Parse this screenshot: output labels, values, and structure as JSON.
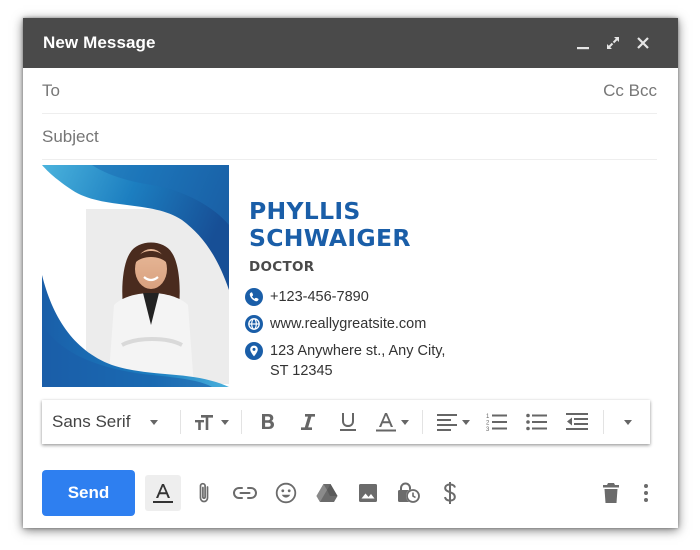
{
  "window": {
    "title": "New Message",
    "controls": [
      {
        "name": "minimize",
        "icon": "minimize-icon"
      },
      {
        "name": "expand",
        "icon": "expand-icon"
      },
      {
        "name": "close",
        "icon": "close-icon"
      }
    ]
  },
  "fields": {
    "to_label": "To",
    "to_value": "",
    "cc_label": "Cc",
    "bcc_label": "Bcc",
    "subject_placeholder": "Subject",
    "subject_value": ""
  },
  "signature": {
    "name_line1": "PHYLLIS",
    "name_line2": "SCHWAIGER",
    "role": "DOCTOR",
    "phone": "+123-456-7890",
    "website": "www.reallygreatsite.com",
    "address_line1": "123 Anywhere st., Any City,",
    "address_line2": "ST 12345",
    "accent_color": "#1a5ea8"
  },
  "format_toolbar": {
    "font": "Sans Serif",
    "items": [
      "font-size",
      "bold",
      "italic",
      "underline",
      "text-color",
      "align",
      "numbered-list",
      "bulleted-list",
      "indent-less",
      "more"
    ]
  },
  "bottom_bar": {
    "send_label": "Send",
    "icons": [
      "formatting-options-icon",
      "attach-icon",
      "link-icon",
      "emoji-icon",
      "drive-icon",
      "photo-icon",
      "confidential-mode-icon",
      "money-icon",
      "discard-icon",
      "more-options-icon"
    ],
    "send_color": "#2e7ff0"
  }
}
